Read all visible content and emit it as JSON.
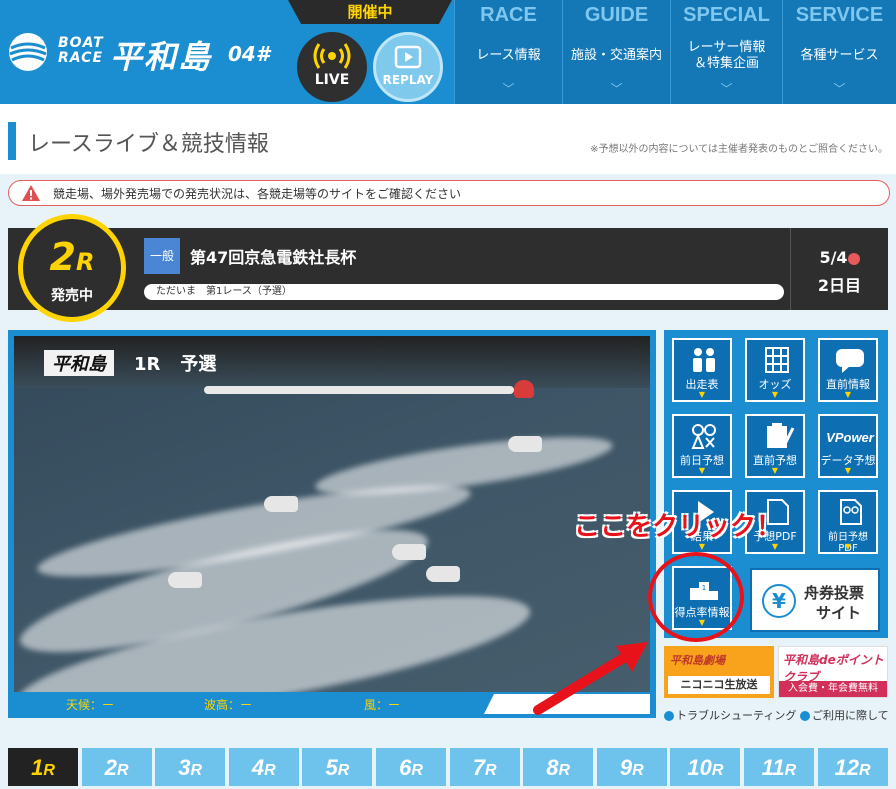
{
  "header": {
    "logo": {
      "boat": "BOAT",
      "race": "RACE",
      "venue": "平和島",
      "code": "04#"
    },
    "status": "開催中",
    "live_label": "LIVE",
    "replay_label": "REPLAY",
    "nav": [
      {
        "en": "RACE",
        "jp": "レース情報"
      },
      {
        "en": "GUIDE",
        "jp": "施設・交通案内"
      },
      {
        "en": "SPECIAL",
        "jp": "レーサー情報",
        "jp2": "＆特集企画"
      },
      {
        "en": "SERVICE",
        "jp": "各種サービス"
      }
    ]
  },
  "page": {
    "title": "レースライブ＆競技情報",
    "disclaimer": "※予想以外の内容については主催者発表のものとご照合ください。",
    "alert": "競走場、場外発売場での発売状況は、各競走場等のサイトをご確認ください"
  },
  "race": {
    "number": "2",
    "suffix": "R",
    "status": "発売中",
    "grade": "一般",
    "name": "第47回京急電鉄社長杯",
    "subtitle": "ただいま　第1レース（予選）",
    "date": "5/4",
    "day": "2日目"
  },
  "video": {
    "venue": "平和島",
    "race": "1R",
    "type": "予選"
  },
  "weather": {
    "tenki": "天候：ー",
    "hakou": "波高：ー",
    "kaze": "風：ー"
  },
  "menu": [
    {
      "label": "出走表"
    },
    {
      "label": "オッズ"
    },
    {
      "label": "直前情報"
    },
    {
      "label": "前日予想"
    },
    {
      "label": "直前予想"
    },
    {
      "label": "データ予想"
    },
    {
      "label": "結果"
    },
    {
      "label": "予想PDF"
    },
    {
      "label": "前日予想PDF"
    },
    {
      "label": "得点率情報"
    }
  ],
  "ticket": {
    "line1": "舟券投票",
    "line2": "サイト"
  },
  "banners": {
    "nico_top": "平和島劇場",
    "nico_bottom": "ニコニコ生放送",
    "point_top": "平和島deポイントクラブ",
    "point_bottom": "入会費・年会費無料"
  },
  "links": {
    "trouble": "トラブルシューティング",
    "usage": "ご利用に際して"
  },
  "annotation": "ここをクリック！",
  "race_tabs": [
    "1",
    "2",
    "3",
    "4",
    "5",
    "6",
    "7",
    "8",
    "9",
    "10",
    "11",
    "12"
  ],
  "race_tab_suffix": "R",
  "colors": {
    "brand": "#1a8ed0",
    "accent": "#ffd400",
    "alert": "#e8121b"
  }
}
